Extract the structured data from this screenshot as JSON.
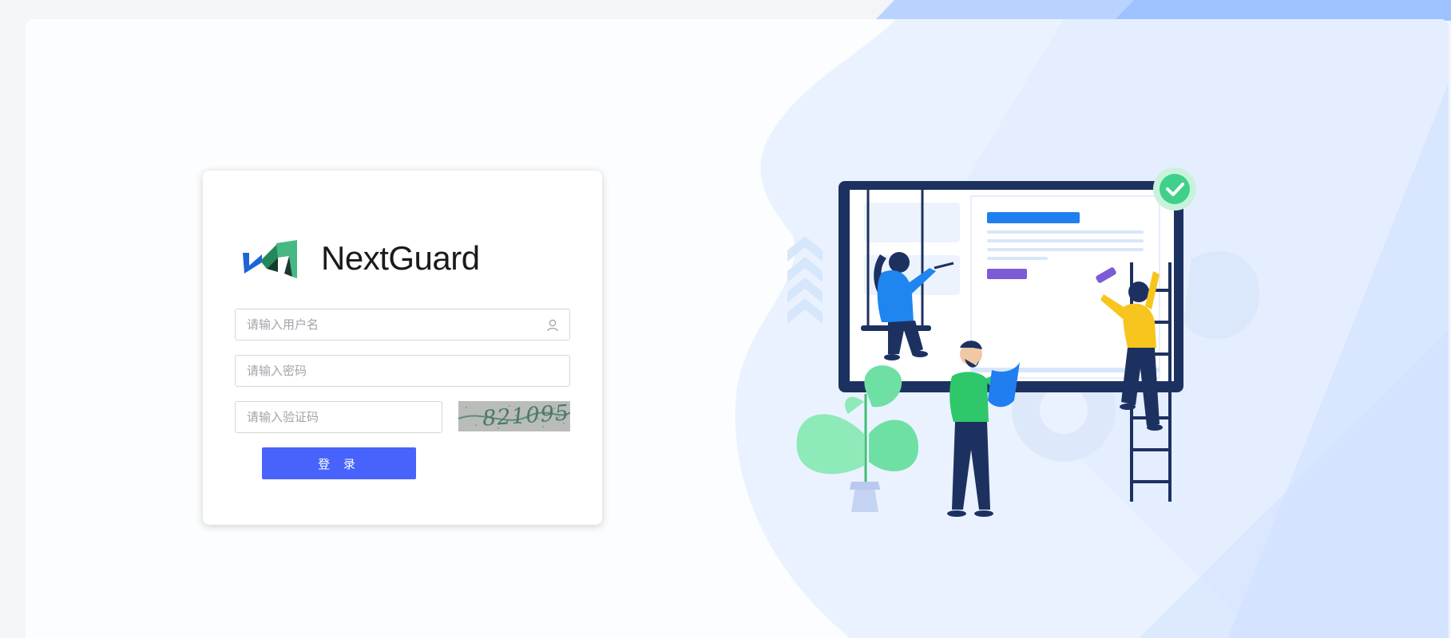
{
  "brand": {
    "name": "NextGuard",
    "logo_icon": "nextguard-logo-icon"
  },
  "login": {
    "username_placeholder": "请输入用户名",
    "password_placeholder": "请输入密码",
    "captcha_placeholder": "请输入验证码",
    "captcha_code": "821095",
    "submit_label": "登 录",
    "username_icon": "user-icon"
  },
  "colors": {
    "primary_button": "#4863fc",
    "background_accent": "#dce9ff",
    "illustration_navy": "#1d3161"
  }
}
